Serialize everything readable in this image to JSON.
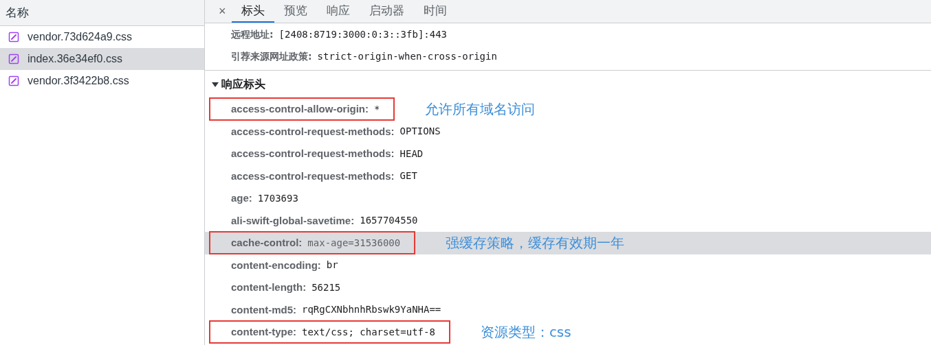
{
  "sidebar": {
    "header": "名称",
    "files": [
      {
        "name": "vendor.73d624a9.css",
        "selected": false
      },
      {
        "name": "index.36e34ef0.css",
        "selected": true
      },
      {
        "name": "vendor.3f3422b8.css",
        "selected": false
      }
    ]
  },
  "details": {
    "close": "×",
    "tabs": [
      {
        "label": "标头",
        "selected": true
      },
      {
        "label": "预览",
        "selected": false
      },
      {
        "label": "响应",
        "selected": false
      },
      {
        "label": "启动器",
        "selected": false
      },
      {
        "label": "时间",
        "selected": false
      }
    ],
    "general_rows": [
      {
        "name": "远程地址:",
        "value": "[2408:8719:3000:0:3::3fb]:443"
      },
      {
        "name": "引荐来源网址政策:",
        "value": "strict-origin-when-cross-origin"
      }
    ],
    "section": {
      "title": "响应标头",
      "expanded": true,
      "headers": [
        {
          "name": "access-control-allow-origin:",
          "value": "*",
          "boxed": true,
          "highlighted": false,
          "note": "允许所有域名访问"
        },
        {
          "name": "access-control-request-methods:",
          "value": "OPTIONS",
          "boxed": false,
          "highlighted": false
        },
        {
          "name": "access-control-request-methods:",
          "value": "HEAD",
          "boxed": false,
          "highlighted": false
        },
        {
          "name": "access-control-request-methods:",
          "value": "GET",
          "boxed": false,
          "highlighted": false
        },
        {
          "name": "age:",
          "value": "1703693",
          "boxed": false,
          "highlighted": false
        },
        {
          "name": "ali-swift-global-savetime:",
          "value": "1657704550",
          "boxed": false,
          "highlighted": false
        },
        {
          "name": "cache-control:",
          "value": "max-age=31536000",
          "boxed": true,
          "highlighted": true,
          "note": "强缓存策略，缓存有效期一年"
        },
        {
          "name": "content-encoding:",
          "value": "br",
          "boxed": false,
          "highlighted": false
        },
        {
          "name": "content-length:",
          "value": "56215",
          "boxed": false,
          "highlighted": false
        },
        {
          "name": "content-md5:",
          "value": "rqRgCXNbhnhRbswk9YaNHA==",
          "boxed": false,
          "highlighted": false
        },
        {
          "name": "content-type:",
          "value": "text/css; charset=utf-8",
          "boxed": true,
          "highlighted": false,
          "note": "资源类型：css"
        }
      ]
    }
  }
}
